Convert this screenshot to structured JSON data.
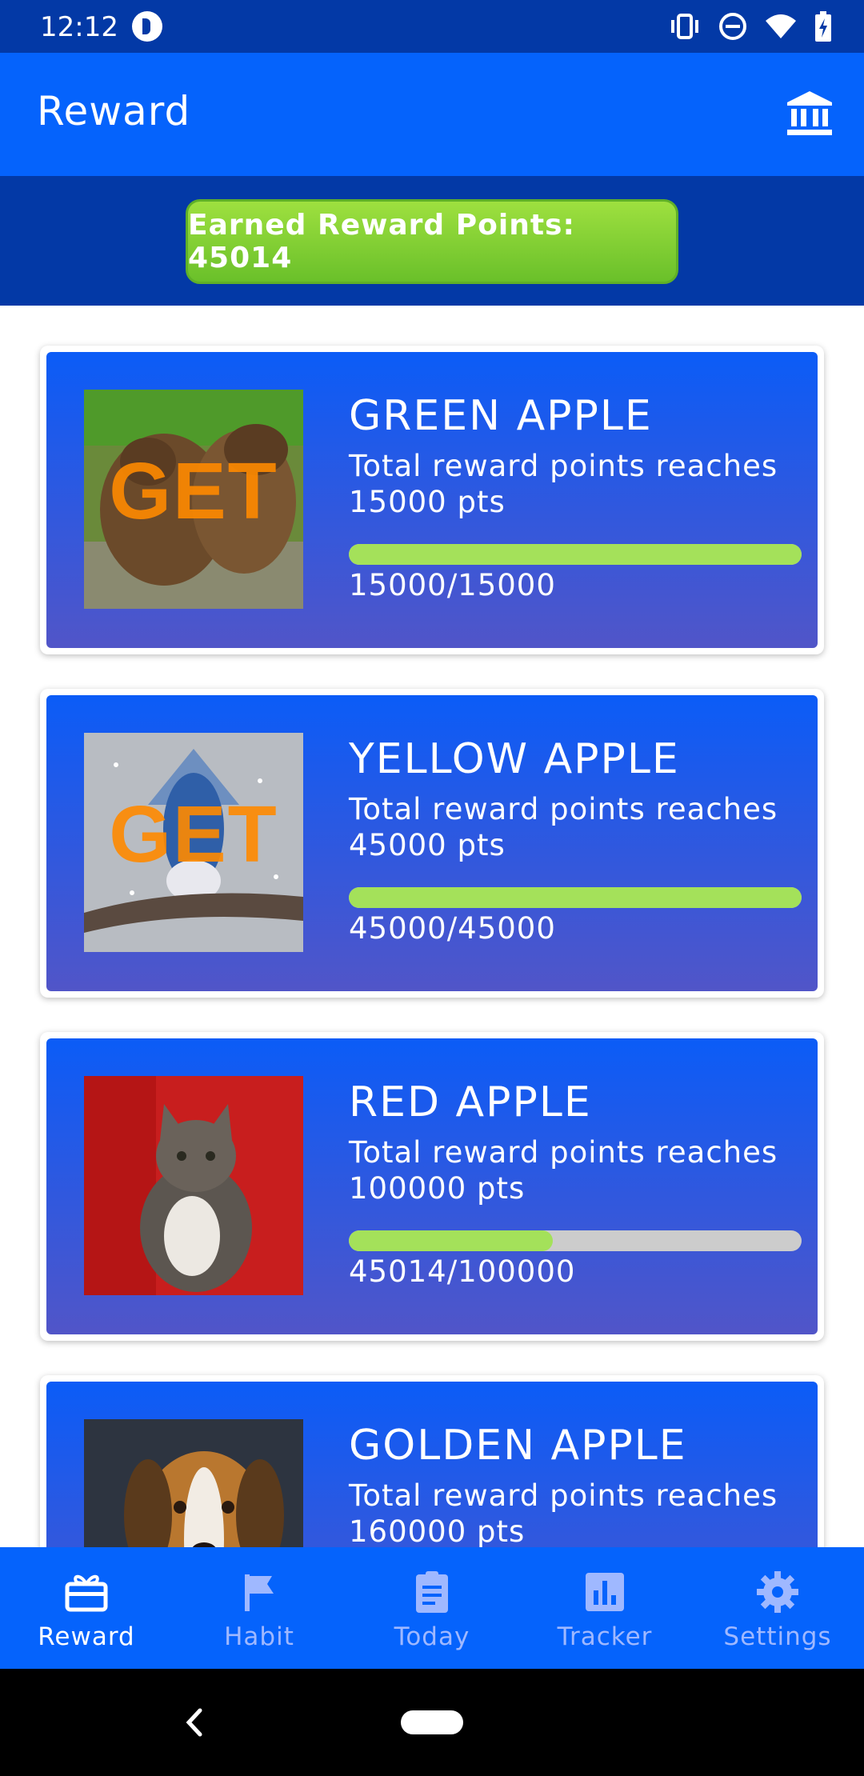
{
  "status_bar": {
    "time": "12:12"
  },
  "app_bar": {
    "title": "Reward",
    "action_icon": "bank-icon"
  },
  "points": {
    "label": "Earned Reward Points: 45014"
  },
  "rewards": [
    {
      "name": "GREEN APPLE",
      "desc_line1": "Total reward points reaches",
      "desc_line2": "15000 pts",
      "progress_text": "15000/15000",
      "progress": 1.0,
      "image": "bears",
      "badge": "GET"
    },
    {
      "name": "YELLOW APPLE",
      "desc_line1": "Total reward points reaches",
      "desc_line2": "45000 pts",
      "progress_text": "45000/45000",
      "progress": 1.0,
      "image": "blue-jay",
      "badge": "GET"
    },
    {
      "name": "RED APPLE",
      "desc_line1": "Total reward points reaches",
      "desc_line2": "100000 pts",
      "progress_text": "45014/100000",
      "progress": 0.45014,
      "image": "kitten"
    },
    {
      "name": "GOLDEN APPLE",
      "desc_line1": "Total reward points reaches",
      "desc_line2": "160000 pts",
      "image": "beagle"
    }
  ],
  "bottom_nav": [
    {
      "label": "Reward",
      "icon": "gift-icon",
      "active": true
    },
    {
      "label": "Habit",
      "icon": "flag-icon"
    },
    {
      "label": "Today",
      "icon": "clipboard-icon"
    },
    {
      "label": "Tracker",
      "icon": "bar-chart-icon"
    },
    {
      "label": "Settings",
      "icon": "gear-icon"
    }
  ],
  "colors": {
    "primary": "#0563fc",
    "dark_primary": "#0339a6",
    "progress": "#a4e15a",
    "progress_track": "#cccccc",
    "points_green": "#7ccc2e"
  }
}
